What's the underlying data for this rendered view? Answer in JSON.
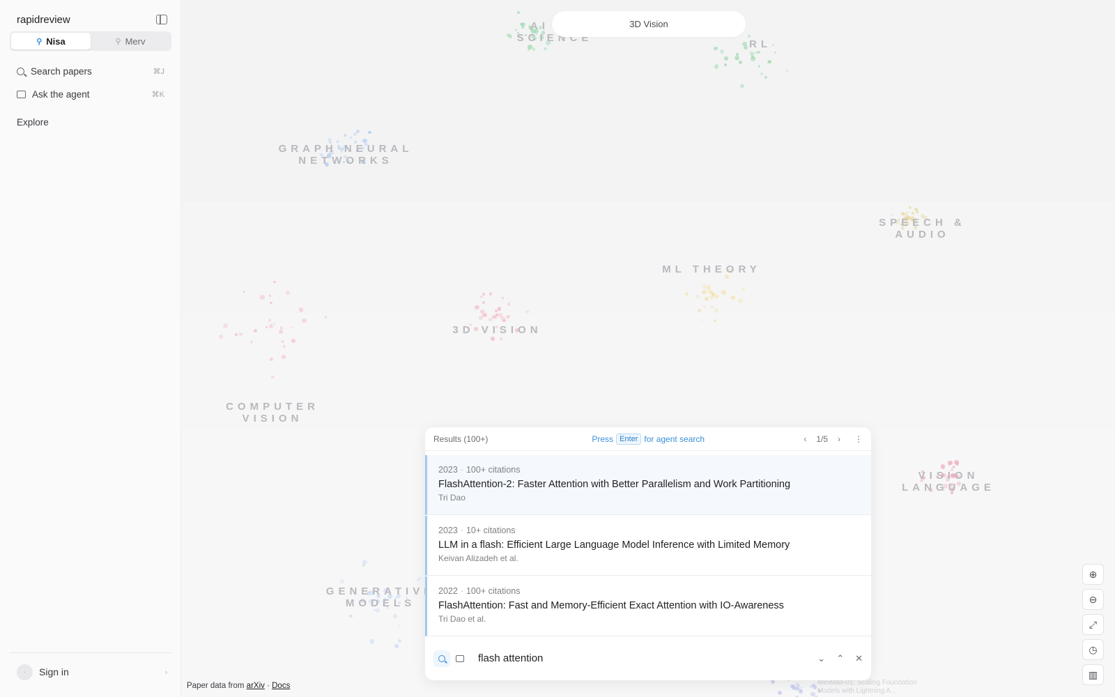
{
  "sidebar": {
    "brand": "rapidreview",
    "profiles": [
      {
        "label": "Nisa",
        "active": true
      },
      {
        "label": "Merv",
        "active": false
      }
    ],
    "nav": [
      {
        "label": "Search papers",
        "shortcut": "⌘J"
      },
      {
        "label": "Ask the agent",
        "shortcut": "⌘K"
      }
    ],
    "explore_label": "Explore",
    "signin_label": "Sign in"
  },
  "map": {
    "topic_pill": "3D Vision",
    "clusters": [
      {
        "label": "AI FOR SCIENCE",
        "line1": "AI FO",
        "line2": "SCIENCE"
      },
      {
        "label": "RL",
        "line1": "RL",
        "line2": ""
      },
      {
        "label": "GRAPH NEURAL NETWORKS",
        "line1": "GRAPH NEURAL",
        "line2": "NETWORKS"
      },
      {
        "label": "SPEECH & AUDIO",
        "line1": "SPEECH &",
        "line2": "AUDIO"
      },
      {
        "label": "ML THEORY",
        "line1": "ML THEORY",
        "line2": ""
      },
      {
        "label": "3D VISION",
        "line1": "3D VISION",
        "line2": ""
      },
      {
        "label": "COMPUTER VISION",
        "line1": "COMPUTER",
        "line2": "VISION"
      },
      {
        "label": "VISION LANGUAGE",
        "line1": "VISION LANGUAGE",
        "line2": ""
      },
      {
        "label": "GENERATIVE MODELS",
        "line1": "GENERATIVE",
        "line2": "MODELS"
      }
    ],
    "faint_annotation_1": "MiniMax-01: Scaling Foundation",
    "faint_annotation_2": "Models with Lightning A..."
  },
  "results": {
    "count_label": "Results (100+)",
    "press_label": "Press",
    "enter_label": "Enter",
    "agent_hint": "for agent search",
    "page_label": "1/5",
    "items": [
      {
        "year": "2023",
        "citations": "100+ citations",
        "title": "FlashAttention-2: Faster Attention with Better Parallelism and Work Partitioning",
        "authors": "Tri Dao"
      },
      {
        "year": "2023",
        "citations": "10+ citations",
        "title": "LLM in a flash: Efficient Large Language Model Inference with Limited Memory",
        "authors": "Keivan Alizadeh et al."
      },
      {
        "year": "2022",
        "citations": "100+ citations",
        "title": "FlashAttention: Fast and Memory-Efficient Exact Attention with IO-Awareness",
        "authors": "Tri Dao et al."
      }
    ],
    "query": "flash attention"
  },
  "footer": {
    "prefix": "Paper data from",
    "arxiv": "arXiv",
    "sep": "·",
    "docs": "Docs"
  },
  "icons": {
    "zoom_in": "zoom-in-icon",
    "zoom_out": "zoom-out-icon",
    "expand": "expand-icon",
    "history": "clock-icon",
    "map": "map-icon"
  },
  "colors": {
    "accent": "#3b8fd8",
    "result_border": "#9fcaf0"
  }
}
